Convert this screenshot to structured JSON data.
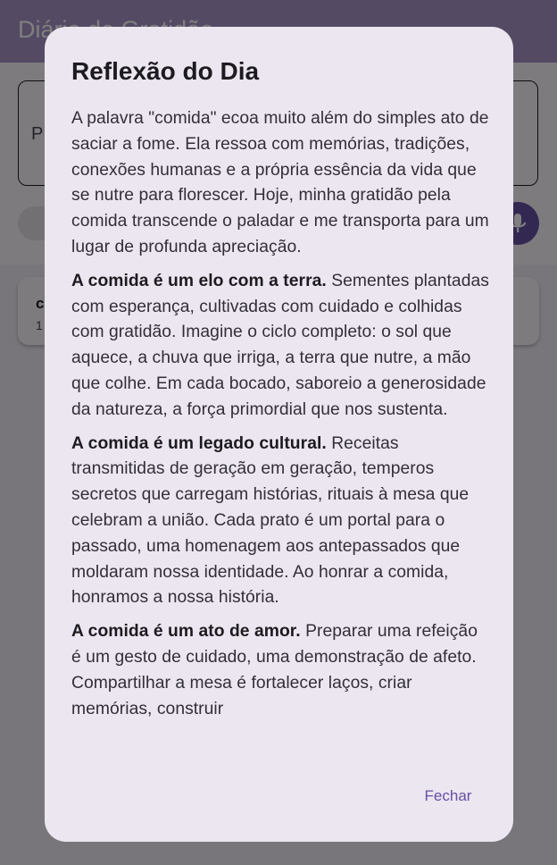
{
  "app": {
    "title": "Diário de Gratidão",
    "entry_placeholder": "P",
    "card": {
      "title": "c",
      "subtitle": "1"
    }
  },
  "colors": {
    "primary": "#6750a4",
    "appbar": "#a994c9",
    "dialog_surface": "#ece6f0",
    "scrim": "rgba(0,0,0,0.5)"
  },
  "dialog": {
    "title": "Reflexão do Dia",
    "paragraphs": [
      {
        "lead": "",
        "text": "A palavra \"comida\" ecoa muito além do simples ato de saciar a fome. Ela ressoa com memórias, tradições, conexões humanas e a própria essência da vida que se nutre para florescer. Hoje, minha gratidão pela comida transcende o paladar e me transporta para um lugar de profunda apreciação."
      },
      {
        "lead": "A comida é um elo com a terra.",
        "text": " Sementes plantadas com esperança, cultivadas com cuidado e colhidas com gratidão. Imagine o ciclo completo: o sol que aquece, a chuva que irriga, a terra que nutre, a mão que colhe. Em cada bocado, saboreio a generosidade da natureza, a força primordial que nos sustenta."
      },
      {
        "lead": "A comida é um legado cultural.",
        "text": " Receitas transmitidas de geração em geração, temperos secretos que carregam histórias, rituais à mesa que celebram a união. Cada prato é um portal para o passado, uma homenagem aos antepassados que moldaram nossa identidade. Ao honrar a comida, honramos a nossa história."
      },
      {
        "lead": "A comida é um ato de amor.",
        "text": " Preparar uma refeição é um gesto de cuidado, uma demonstração de afeto. Compartilhar a mesa é fortalecer laços, criar memórias, construir"
      }
    ],
    "close_label": "Fechar"
  },
  "icons": {
    "mic": "mic-icon"
  }
}
